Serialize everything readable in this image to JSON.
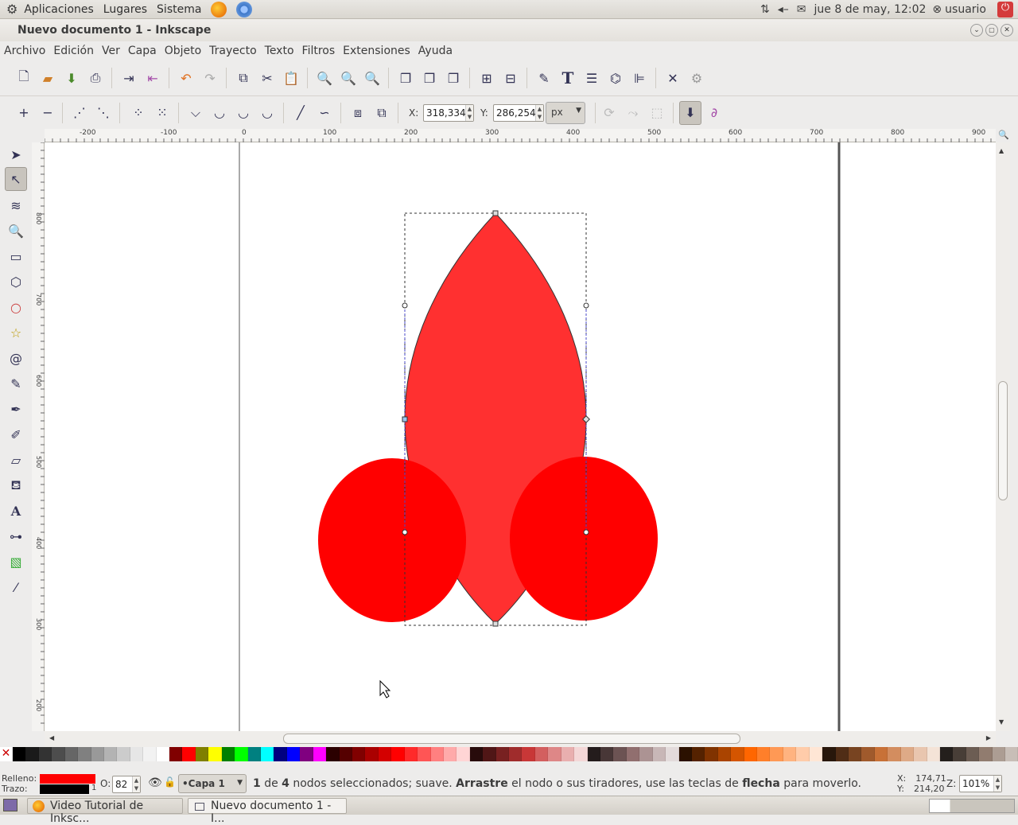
{
  "top_panel": {
    "menus": [
      "Aplicaciones",
      "Lugares",
      "Sistema"
    ],
    "clock": "jue  8 de may, 12:02",
    "user": "usuario"
  },
  "window": {
    "title": "Nuevo documento 1 - Inkscape"
  },
  "menubar": [
    "Archivo",
    "Edición",
    "Ver",
    "Capa",
    "Objeto",
    "Trayecto",
    "Texto",
    "Filtros",
    "Extensiones",
    "Ayuda"
  ],
  "controls": {
    "x_label": "X:",
    "x_value": "318,334",
    "y_label": "Y:",
    "y_value": "286,254",
    "unit": "px"
  },
  "ruler": {
    "top_ticks": [
      "-200",
      "-100",
      "0",
      "100",
      "200",
      "300",
      "400",
      "500",
      "600",
      "700",
      "800",
      "900"
    ],
    "left_ticks": [
      "800",
      "700",
      "600",
      "500",
      "400",
      "300",
      "200"
    ]
  },
  "status": {
    "fill_label": "Relleno:",
    "stroke_label": "Trazo:",
    "stroke_width": "1",
    "opacity_label": "O:",
    "opacity_value": "82",
    "layer": "•Capa 1",
    "message_pre": "1",
    "message_mid1": " de ",
    "message_count": "4",
    "message_mid2": " nodos seleccionados; suave. ",
    "message_b1": "Arrastre",
    "message_mid3": " el nodo o sus tiradores, use las teclas de ",
    "message_b2": "flecha",
    "message_end": " para moverlo.",
    "cursor_x_label": "X:",
    "cursor_x": "174,71",
    "cursor_y_label": "Y:",
    "cursor_y": "214,20",
    "zoom_label": "Z:",
    "zoom": "101%",
    "fill_color": "#ff0000",
    "stroke_color": "#000000"
  },
  "taskbar": {
    "items": [
      "Video Tutorial de Inksc...",
      "Nuevo documento 1 - I..."
    ]
  },
  "palette": [
    "#000000",
    "#1a1a1a",
    "#333333",
    "#4d4d4d",
    "#666666",
    "#808080",
    "#999999",
    "#b3b3b3",
    "#cccccc",
    "#e6e6e6",
    "#f2f2f2",
    "#ffffff",
    "#800000",
    "#ff0000",
    "#808000",
    "#ffff00",
    "#008000",
    "#00ff00",
    "#008080",
    "#00ffff",
    "#000080",
    "#0000ff",
    "#800080",
    "#ff00ff",
    "#2b0000",
    "#550000",
    "#800000",
    "#aa0000",
    "#d40000",
    "#ff0000",
    "#ff2a2a",
    "#ff5555",
    "#ff8080",
    "#ffaaaa",
    "#ffd5d5",
    "#280b0b",
    "#501616",
    "#782121",
    "#a02c2c",
    "#c83737",
    "#d35f5f",
    "#de8787",
    "#e9afaf",
    "#f4d7d7",
    "#241c1c",
    "#483737",
    "#6c5353",
    "#916f6f",
    "#ac9393",
    "#c8b7b7",
    "#e3dbdb",
    "#2b1100",
    "#552200",
    "#803300",
    "#aa4400",
    "#d45500",
    "#ff6600",
    "#ff7f2a",
    "#ff9955",
    "#ffb380",
    "#ffccaa",
    "#ffe6d5",
    "#28170b",
    "#502d16",
    "#784421",
    "#a05a2c",
    "#c87137",
    "#d38d5f",
    "#deaa87",
    "#e9c6af",
    "#f4e3d7",
    "#241f1c",
    "#483e37",
    "#6c5d53",
    "#917c6f",
    "#ac9d93",
    "#c8beb7"
  ],
  "icons": {
    "close": "close-icon",
    "min": "minimize-icon",
    "max": "maximize-icon"
  }
}
